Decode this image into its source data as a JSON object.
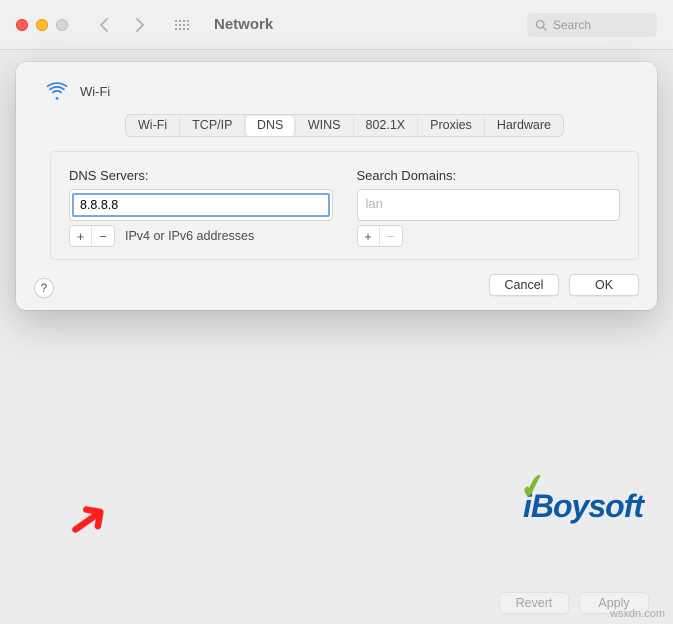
{
  "window": {
    "title": "Network",
    "search_placeholder": "Search"
  },
  "sheet": {
    "connection_name": "Wi-Fi",
    "tabs": [
      "Wi-Fi",
      "TCP/IP",
      "DNS",
      "WINS",
      "802.1X",
      "Proxies",
      "Hardware"
    ],
    "active_tab_index": 2,
    "dns": {
      "label": "DNS Servers:",
      "entries": [
        "8.8.8.8"
      ],
      "hint": "IPv4 or IPv6 addresses"
    },
    "search_domains": {
      "label": "Search Domains:",
      "entries": [
        "lan"
      ]
    },
    "add_label": "+",
    "remove_label": "−",
    "buttons": {
      "cancel": "Cancel",
      "ok": "OK"
    }
  },
  "main_window_buttons": {
    "revert": "Revert",
    "apply": "Apply"
  },
  "watermark": {
    "logo_text": "iBoysoft",
    "site": "wsxdn.com"
  }
}
